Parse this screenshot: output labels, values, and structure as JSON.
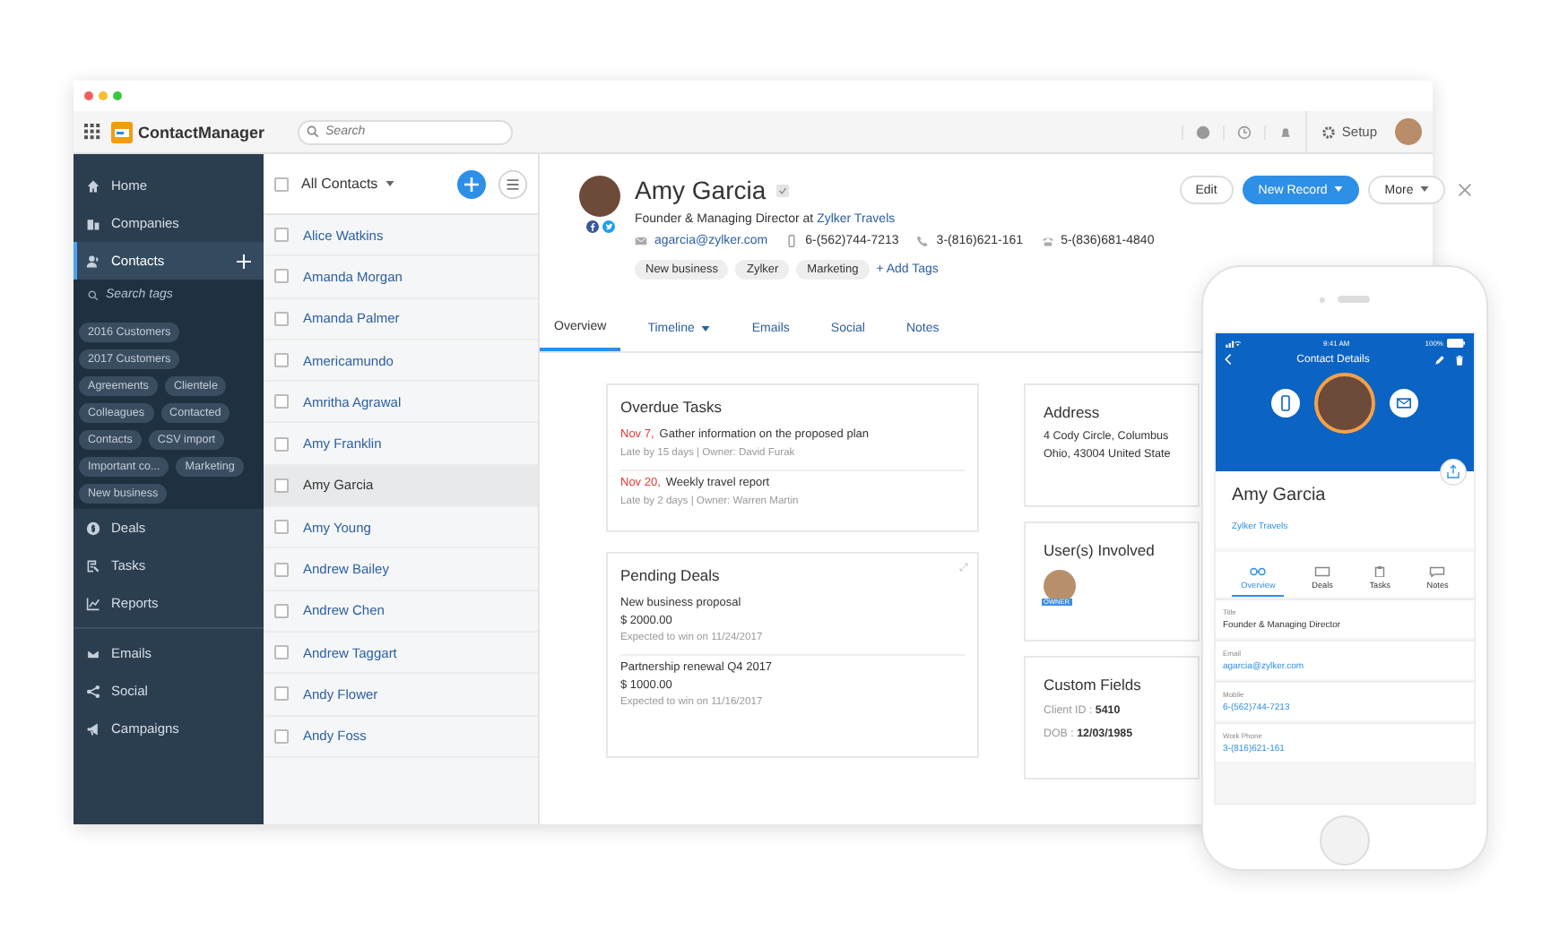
{
  "app": {
    "name": "ContactManager",
    "search_placeholder": "Search",
    "setup": "Setup"
  },
  "sidebar": {
    "top": [
      {
        "label": "Home",
        "selected": false
      },
      {
        "label": "Companies",
        "selected": false
      },
      {
        "label": "Contacts",
        "selected": true
      }
    ],
    "tag_search_placeholder": "Search tags",
    "tags": [
      "2016 Customers",
      "2017 Customers",
      "Agreements",
      "Clientele",
      "Colleagues",
      "Contacted",
      "Contacts",
      "CSV import",
      "Important co...",
      "Marketing",
      "New business"
    ],
    "middle": [
      {
        "label": "Deals",
        "selected": false
      },
      {
        "label": "Tasks",
        "selected": false
      },
      {
        "label": "Reports",
        "selected": false
      }
    ],
    "bottom": [
      {
        "label": "Emails",
        "selected": false
      },
      {
        "label": "Social",
        "selected": false
      },
      {
        "label": "Campaigns",
        "selected": false
      }
    ]
  },
  "contact_list": {
    "title": "All Contacts",
    "checked": false,
    "rows": [
      {
        "name": "Alice Watkins",
        "checked": false,
        "selected": false
      },
      {
        "name": "Amanda Morgan",
        "checked": false,
        "selected": false
      },
      {
        "name": "Amanda Palmer",
        "checked": false,
        "selected": false
      },
      {
        "name": "Americamundo",
        "checked": false,
        "selected": false
      },
      {
        "name": "Amritha Agrawal",
        "checked": false,
        "selected": false
      },
      {
        "name": "Amy Franklin",
        "checked": false,
        "selected": false
      },
      {
        "name": "Amy Garcia",
        "checked": false,
        "selected": true
      },
      {
        "name": "Amy Young",
        "checked": false,
        "selected": false
      },
      {
        "name": "Andrew Bailey",
        "checked": false,
        "selected": false
      },
      {
        "name": "Andrew Chen",
        "checked": false,
        "selected": false
      },
      {
        "name": "Andrew Taggart",
        "checked": false,
        "selected": false
      },
      {
        "name": "Andy Flower",
        "checked": false,
        "selected": false
      },
      {
        "name": "Andy Foss",
        "checked": false,
        "selected": false
      }
    ]
  },
  "detail": {
    "name": "Amy Garcia",
    "role": "Founder & Managing Director at",
    "company": "Zylker Travels",
    "email": "agarcia@zylker.com",
    "mobile": "6-(562)744-7213",
    "phone": "3-(816)621-161",
    "fax": "5-(836)681-4840",
    "tags": [
      "New business",
      "Zylker",
      "Marketing"
    ],
    "add_tags": "+ Add Tags",
    "buttons": [
      {
        "label": "Edit",
        "kind": "plain"
      },
      {
        "label": "New Record",
        "kind": "primary"
      },
      {
        "label": "More",
        "kind": "menu"
      }
    ],
    "tabs": [
      {
        "label": "Overview",
        "selected": true,
        "menu": false
      },
      {
        "label": "Timeline",
        "selected": false,
        "menu": true
      },
      {
        "label": "Emails",
        "selected": false,
        "menu": false
      },
      {
        "label": "Social",
        "selected": false,
        "menu": false
      },
      {
        "label": "Notes",
        "selected": false,
        "menu": false
      }
    ],
    "overdue_tasks": {
      "title": "Overdue Tasks",
      "items": [
        {
          "date": "Nov 7,",
          "text": "Gather information on the proposed plan",
          "meta": "Late by 15 days | Owner: David Furak"
        },
        {
          "date": "Nov 20,",
          "text": "Weekly travel report",
          "meta": "Late by 2 days | Owner: Warren Martin"
        }
      ]
    },
    "pending_deals": {
      "title": "Pending Deals",
      "items": [
        {
          "name": "New business proposal",
          "amount": "$ 2000.00",
          "expected": "Expected to win on 11/24/2017"
        },
        {
          "name": "Partnership renewal Q4 2017",
          "amount": "$ 1000.00",
          "expected": "Expected to win on 11/16/2017"
        }
      ]
    },
    "address": {
      "title": "Address",
      "lines": [
        "4 Cody Circle, Columbus",
        "Ohio, 43004 United State"
      ]
    },
    "users_involved": {
      "title": "User(s) Involved",
      "badge": "OWNER"
    },
    "custom_fields": {
      "title": "Custom Fields",
      "fields": [
        {
          "label": "Client ID :",
          "value": "5410"
        },
        {
          "label": "DOB :",
          "value": "12/03/1985"
        }
      ]
    }
  },
  "phone": {
    "time": "9:41 AM",
    "battery": "100%",
    "title": "Contact Details",
    "name": "Amy Garcia",
    "company": "Zylker Travels",
    "tabs": [
      {
        "label": "Overview",
        "selected": true
      },
      {
        "label": "Deals",
        "selected": false
      },
      {
        "label": "Tasks",
        "selected": false
      },
      {
        "label": "Notes",
        "selected": false
      }
    ],
    "fields": [
      {
        "label": "Title",
        "value": "Founder & Managing Director",
        "kind": "text"
      },
      {
        "label": "Email",
        "value": "agarcia@zylker.com",
        "kind": "link"
      },
      {
        "label": "Mobile",
        "value": "6-(562)744-7213",
        "kind": "link"
      },
      {
        "label": "Work Phone",
        "value": "3-(816)621-161",
        "kind": "link"
      }
    ]
  }
}
